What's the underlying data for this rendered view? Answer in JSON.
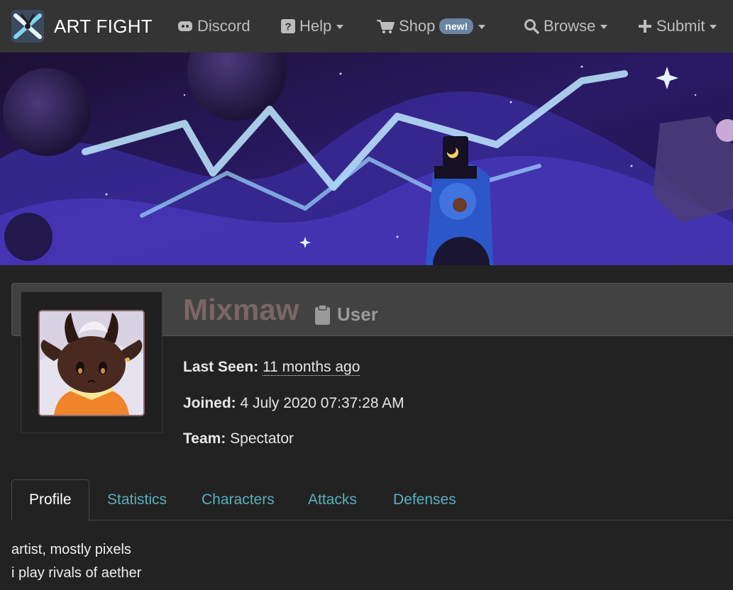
{
  "nav": {
    "brand": "ART FIGHT",
    "items": [
      {
        "label": "Discord",
        "icon": "discord-icon"
      },
      {
        "label": "Help",
        "icon": "question-icon"
      },
      {
        "label": "Shop",
        "icon": "cart-icon",
        "badge": "new!"
      },
      {
        "label": "Browse",
        "icon": "search-icon"
      },
      {
        "label": "Submit",
        "icon": "plus-icon"
      }
    ]
  },
  "profile": {
    "username": "Mixmaw",
    "role": "User",
    "last_seen_label": "Last Seen:",
    "last_seen_value": "11 months ago",
    "joined_label": "Joined:",
    "joined_value": "4 July 2020 07:37:28 AM",
    "team_label": "Team:",
    "team_value": "Spectator"
  },
  "tabs": [
    {
      "label": "Profile",
      "active": true
    },
    {
      "label": "Statistics"
    },
    {
      "label": "Characters"
    },
    {
      "label": "Attacks"
    },
    {
      "label": "Defenses"
    }
  ],
  "bio": [
    "artist, mostly pixels",
    "i play rivals of aether"
  ],
  "colors": {
    "navbar": "#343434",
    "background": "#222222",
    "tab_link": "#58b0bd",
    "username": "#7b6666"
  }
}
